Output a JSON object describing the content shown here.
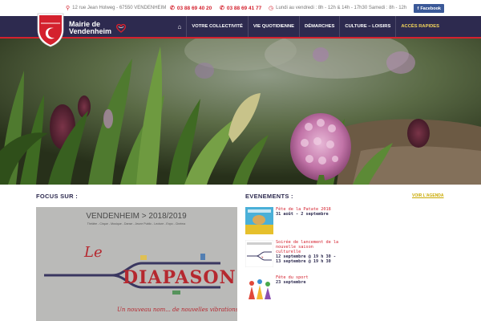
{
  "topbar": {
    "address": "12 rue Jean Holweg - 67550 VENDENHEIM",
    "phone1": "03 88 69 40 20",
    "phone2": "03 88 69 41 77",
    "hours": "Lundi au vendredi : 8h - 12h & 14h - 17h30 Samedi : 8h - 12h",
    "facebook_label": "Facebook"
  },
  "logo": {
    "line1": "Mairie de",
    "line2": "Vendenheim"
  },
  "nav": {
    "items": [
      {
        "label": "VOTRE COLLECTIVITÉ"
      },
      {
        "label": "VIE QUOTIDIENNE"
      },
      {
        "label": "DÉMARCHES"
      },
      {
        "label": "CULTURE – LOISIRS"
      },
      {
        "label": "ACCÈS RAPIDES"
      }
    ]
  },
  "focus": {
    "title": "FOCUS SUR :",
    "banner_heading": "VENDENHEIM > 2018/2019",
    "banner_sub": "Théâtre - Cirque - Musique - Danse - Jeune Public - Lecture - Expo - Cinéma",
    "banner_word1": "Le",
    "banner_word2": "DIAPASON",
    "banner_tagline": "Un nouveau nom... de nouvelles vibrations..."
  },
  "events": {
    "title": "EVENEMENTS :",
    "agenda_link": "VOIR L'AGENDA",
    "items": [
      {
        "title": "Fête de la Patate 2018",
        "date": "31 août - 2 septembre"
      },
      {
        "title": "Soirée de lancement de la nouvelle saison culturelle",
        "date": "12 septembre @ 19 h 30 - 13 septembre @ 19 h 30"
      },
      {
        "title": "Fête du sport",
        "date": "23 septembre"
      }
    ]
  },
  "colors": {
    "brand_navy": "#2d2a4f",
    "brand_red": "#d4212e",
    "accent_yellow": "#f3d55b",
    "facebook_blue": "#3b5998"
  }
}
